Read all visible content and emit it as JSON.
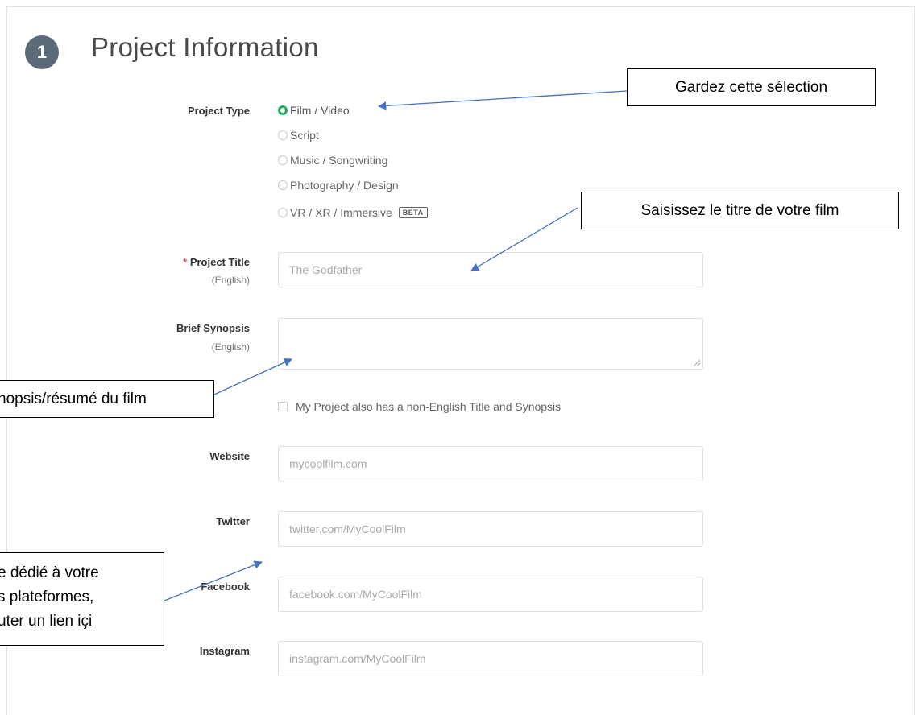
{
  "section": {
    "step_number": "1",
    "title": "Project Information"
  },
  "project_type": {
    "label": "Project Type",
    "options": [
      {
        "label": "Film / Video",
        "checked": true
      },
      {
        "label": "Script",
        "checked": false
      },
      {
        "label": "Music / Songwriting",
        "checked": false
      },
      {
        "label": "Photography / Design",
        "checked": false
      },
      {
        "label": "VR / XR / Immersive",
        "checked": false,
        "badge": "BETA"
      }
    ]
  },
  "project_title": {
    "required_mark": "*",
    "label": "Project Title",
    "sublabel": "(English)",
    "placeholder": "The Godfather"
  },
  "synopsis": {
    "label": "Brief Synopsis",
    "sublabel": "(English)",
    "placeholder": ""
  },
  "non_english_checkbox": {
    "label": "My Project also has a non-English Title and Synopsis",
    "checked": false
  },
  "website": {
    "label": "Website",
    "placeholder": "mycoolfilm.com"
  },
  "twitter": {
    "label": "Twitter",
    "placeholder": "twitter.com/MyCoolFilm"
  },
  "facebook": {
    "label": "Facebook",
    "placeholder": "facebook.com/MyCoolFilm"
  },
  "instagram": {
    "label": "Instagram",
    "placeholder": "instagram.com/MyCoolFilm"
  },
  "annotations": {
    "keep_selection": "Gardez cette sélection",
    "enter_title": "Saisissez le titre de votre film",
    "synopsis": "nopsis/résumé du film",
    "social_line1": "e dédié à votre",
    "social_line2": "s plateformes,",
    "social_line3": "uter un lien içi"
  },
  "colors": {
    "radio_checked": "#1fae5b",
    "step_badge": "#5b6a78",
    "arrow": "#4472c4",
    "required": "#d9534f"
  }
}
